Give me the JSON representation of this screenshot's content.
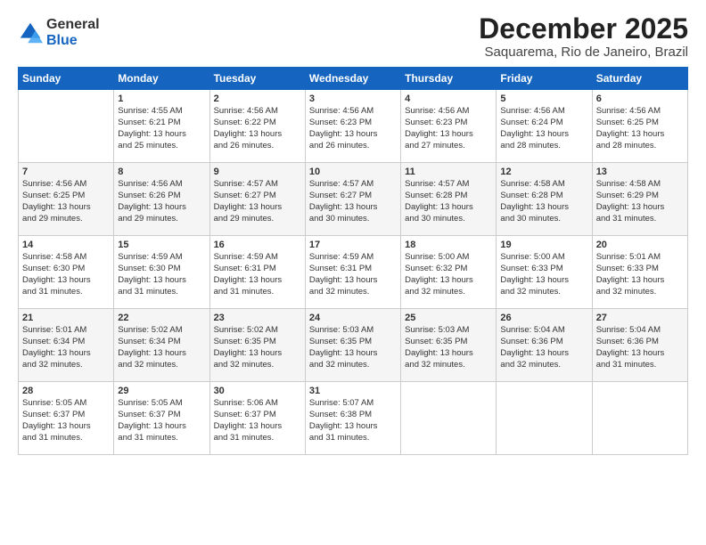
{
  "logo": {
    "line1": "General",
    "line2": "Blue"
  },
  "title": "December 2025",
  "subtitle": "Saquarema, Rio de Janeiro, Brazil",
  "days_of_week": [
    "Sunday",
    "Monday",
    "Tuesday",
    "Wednesday",
    "Thursday",
    "Friday",
    "Saturday"
  ],
  "weeks": [
    [
      {
        "num": "",
        "lines": []
      },
      {
        "num": "1",
        "lines": [
          "Sunrise: 4:55 AM",
          "Sunset: 6:21 PM",
          "Daylight: 13 hours",
          "and 25 minutes."
        ]
      },
      {
        "num": "2",
        "lines": [
          "Sunrise: 4:56 AM",
          "Sunset: 6:22 PM",
          "Daylight: 13 hours",
          "and 26 minutes."
        ]
      },
      {
        "num": "3",
        "lines": [
          "Sunrise: 4:56 AM",
          "Sunset: 6:23 PM",
          "Daylight: 13 hours",
          "and 26 minutes."
        ]
      },
      {
        "num": "4",
        "lines": [
          "Sunrise: 4:56 AM",
          "Sunset: 6:23 PM",
          "Daylight: 13 hours",
          "and 27 minutes."
        ]
      },
      {
        "num": "5",
        "lines": [
          "Sunrise: 4:56 AM",
          "Sunset: 6:24 PM",
          "Daylight: 13 hours",
          "and 28 minutes."
        ]
      },
      {
        "num": "6",
        "lines": [
          "Sunrise: 4:56 AM",
          "Sunset: 6:25 PM",
          "Daylight: 13 hours",
          "and 28 minutes."
        ]
      }
    ],
    [
      {
        "num": "7",
        "lines": [
          "Sunrise: 4:56 AM",
          "Sunset: 6:25 PM",
          "Daylight: 13 hours",
          "and 29 minutes."
        ]
      },
      {
        "num": "8",
        "lines": [
          "Sunrise: 4:56 AM",
          "Sunset: 6:26 PM",
          "Daylight: 13 hours",
          "and 29 minutes."
        ]
      },
      {
        "num": "9",
        "lines": [
          "Sunrise: 4:57 AM",
          "Sunset: 6:27 PM",
          "Daylight: 13 hours",
          "and 29 minutes."
        ]
      },
      {
        "num": "10",
        "lines": [
          "Sunrise: 4:57 AM",
          "Sunset: 6:27 PM",
          "Daylight: 13 hours",
          "and 30 minutes."
        ]
      },
      {
        "num": "11",
        "lines": [
          "Sunrise: 4:57 AM",
          "Sunset: 6:28 PM",
          "Daylight: 13 hours",
          "and 30 minutes."
        ]
      },
      {
        "num": "12",
        "lines": [
          "Sunrise: 4:58 AM",
          "Sunset: 6:28 PM",
          "Daylight: 13 hours",
          "and 30 minutes."
        ]
      },
      {
        "num": "13",
        "lines": [
          "Sunrise: 4:58 AM",
          "Sunset: 6:29 PM",
          "Daylight: 13 hours",
          "and 31 minutes."
        ]
      }
    ],
    [
      {
        "num": "14",
        "lines": [
          "Sunrise: 4:58 AM",
          "Sunset: 6:30 PM",
          "Daylight: 13 hours",
          "and 31 minutes."
        ]
      },
      {
        "num": "15",
        "lines": [
          "Sunrise: 4:59 AM",
          "Sunset: 6:30 PM",
          "Daylight: 13 hours",
          "and 31 minutes."
        ]
      },
      {
        "num": "16",
        "lines": [
          "Sunrise: 4:59 AM",
          "Sunset: 6:31 PM",
          "Daylight: 13 hours",
          "and 31 minutes."
        ]
      },
      {
        "num": "17",
        "lines": [
          "Sunrise: 4:59 AM",
          "Sunset: 6:31 PM",
          "Daylight: 13 hours",
          "and 32 minutes."
        ]
      },
      {
        "num": "18",
        "lines": [
          "Sunrise: 5:00 AM",
          "Sunset: 6:32 PM",
          "Daylight: 13 hours",
          "and 32 minutes."
        ]
      },
      {
        "num": "19",
        "lines": [
          "Sunrise: 5:00 AM",
          "Sunset: 6:33 PM",
          "Daylight: 13 hours",
          "and 32 minutes."
        ]
      },
      {
        "num": "20",
        "lines": [
          "Sunrise: 5:01 AM",
          "Sunset: 6:33 PM",
          "Daylight: 13 hours",
          "and 32 minutes."
        ]
      }
    ],
    [
      {
        "num": "21",
        "lines": [
          "Sunrise: 5:01 AM",
          "Sunset: 6:34 PM",
          "Daylight: 13 hours",
          "and 32 minutes."
        ]
      },
      {
        "num": "22",
        "lines": [
          "Sunrise: 5:02 AM",
          "Sunset: 6:34 PM",
          "Daylight: 13 hours",
          "and 32 minutes."
        ]
      },
      {
        "num": "23",
        "lines": [
          "Sunrise: 5:02 AM",
          "Sunset: 6:35 PM",
          "Daylight: 13 hours",
          "and 32 minutes."
        ]
      },
      {
        "num": "24",
        "lines": [
          "Sunrise: 5:03 AM",
          "Sunset: 6:35 PM",
          "Daylight: 13 hours",
          "and 32 minutes."
        ]
      },
      {
        "num": "25",
        "lines": [
          "Sunrise: 5:03 AM",
          "Sunset: 6:35 PM",
          "Daylight: 13 hours",
          "and 32 minutes."
        ]
      },
      {
        "num": "26",
        "lines": [
          "Sunrise: 5:04 AM",
          "Sunset: 6:36 PM",
          "Daylight: 13 hours",
          "and 32 minutes."
        ]
      },
      {
        "num": "27",
        "lines": [
          "Sunrise: 5:04 AM",
          "Sunset: 6:36 PM",
          "Daylight: 13 hours",
          "and 31 minutes."
        ]
      }
    ],
    [
      {
        "num": "28",
        "lines": [
          "Sunrise: 5:05 AM",
          "Sunset: 6:37 PM",
          "Daylight: 13 hours",
          "and 31 minutes."
        ]
      },
      {
        "num": "29",
        "lines": [
          "Sunrise: 5:05 AM",
          "Sunset: 6:37 PM",
          "Daylight: 13 hours",
          "and 31 minutes."
        ]
      },
      {
        "num": "30",
        "lines": [
          "Sunrise: 5:06 AM",
          "Sunset: 6:37 PM",
          "Daylight: 13 hours",
          "and 31 minutes."
        ]
      },
      {
        "num": "31",
        "lines": [
          "Sunrise: 5:07 AM",
          "Sunset: 6:38 PM",
          "Daylight: 13 hours",
          "and 31 minutes."
        ]
      },
      {
        "num": "",
        "lines": []
      },
      {
        "num": "",
        "lines": []
      },
      {
        "num": "",
        "lines": []
      }
    ]
  ]
}
